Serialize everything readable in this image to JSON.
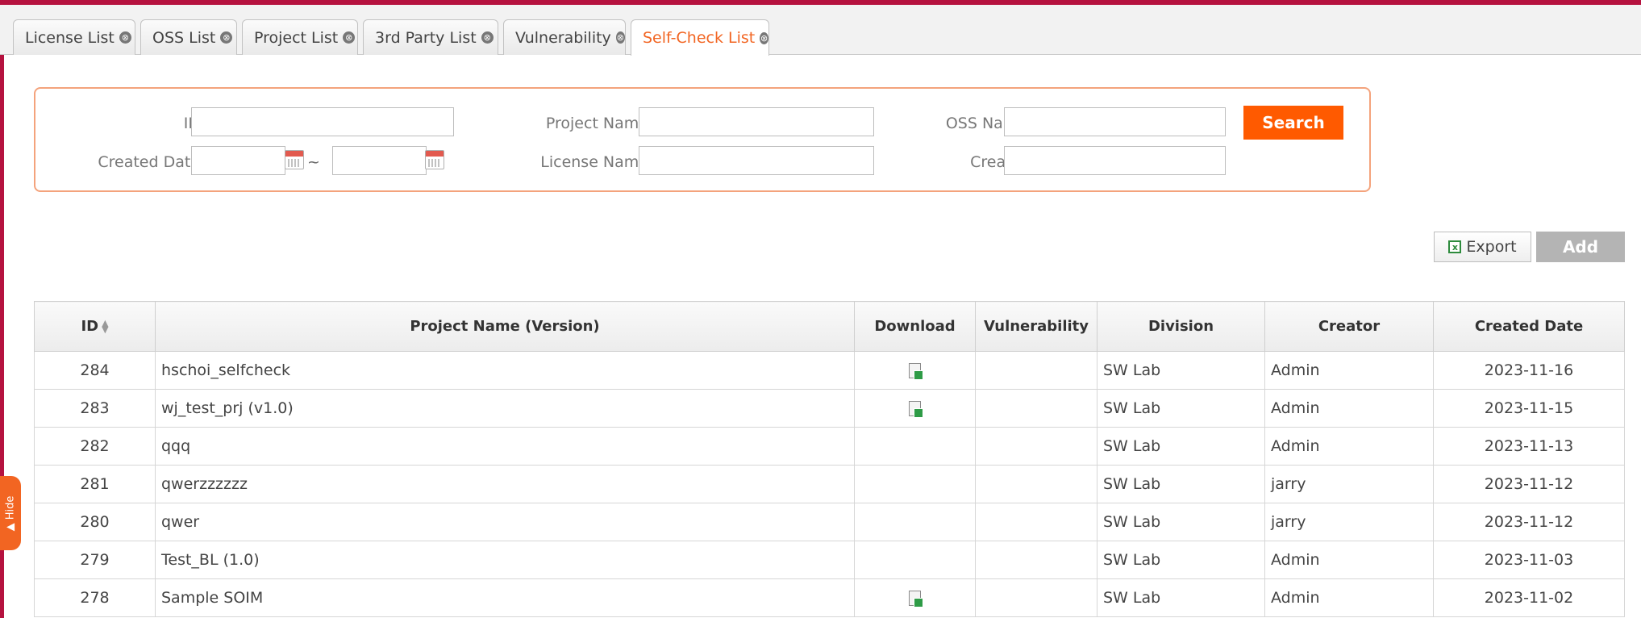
{
  "tabs": [
    {
      "label": "License List"
    },
    {
      "label": "OSS List"
    },
    {
      "label": "Project List"
    },
    {
      "label": "3rd Party List"
    },
    {
      "label": "Vulnerability"
    },
    {
      "label": "Self-Check List"
    }
  ],
  "active_tab": "Self-Check List",
  "close_glyph": "⊗",
  "side_handle": {
    "label": "▲ Hide"
  },
  "search": {
    "id_label": "ID",
    "project_name_label": "Project Name",
    "oss_name_label": "OSS Name",
    "created_date_label": "Created Date",
    "license_name_label": "License Name",
    "creator_label": "Creator",
    "range_separator": "~",
    "search_button": "Search",
    "id_value": "",
    "project_name_value": "",
    "oss_name_value": "",
    "date_from_value": "",
    "date_to_value": "",
    "license_name_value": "",
    "creator_value": ""
  },
  "toolbar": {
    "export_label": "Export",
    "add_label": "Add"
  },
  "table": {
    "headers": {
      "id": "ID",
      "project": "Project Name (Version)",
      "download": "Download",
      "vulnerability": "Vulnerability",
      "division": "Division",
      "creator": "Creator",
      "created_date": "Created Date"
    },
    "rows": [
      {
        "id": "284",
        "project": "hschoi_selfcheck",
        "download": true,
        "vulnerability": "",
        "division": "SW Lab",
        "creator": "Admin",
        "created_date": "2023-11-16"
      },
      {
        "id": "283",
        "project": "wj_test_prj (v1.0)",
        "download": true,
        "vulnerability": "",
        "division": "SW Lab",
        "creator": "Admin",
        "created_date": "2023-11-15"
      },
      {
        "id": "282",
        "project": "qqq",
        "download": false,
        "vulnerability": "",
        "division": "SW Lab",
        "creator": "Admin",
        "created_date": "2023-11-13"
      },
      {
        "id": "281",
        "project": "qwerzzzzzz",
        "download": false,
        "vulnerability": "",
        "division": "SW Lab",
        "creator": "jarry",
        "created_date": "2023-11-12"
      },
      {
        "id": "280",
        "project": "qwer",
        "download": false,
        "vulnerability": "",
        "division": "SW Lab",
        "creator": "jarry",
        "created_date": "2023-11-12"
      },
      {
        "id": "279",
        "project": "Test_BL (1.0)",
        "download": false,
        "vulnerability": "",
        "division": "SW Lab",
        "creator": "Admin",
        "created_date": "2023-11-03"
      },
      {
        "id": "278",
        "project": "Sample SOIM",
        "download": true,
        "vulnerability": "",
        "division": "SW Lab",
        "creator": "Admin",
        "created_date": "2023-11-02"
      }
    ]
  },
  "colors": {
    "accent": "#ff5a00",
    "brand": "#b5123f",
    "active_tab_text": "#f26522"
  }
}
